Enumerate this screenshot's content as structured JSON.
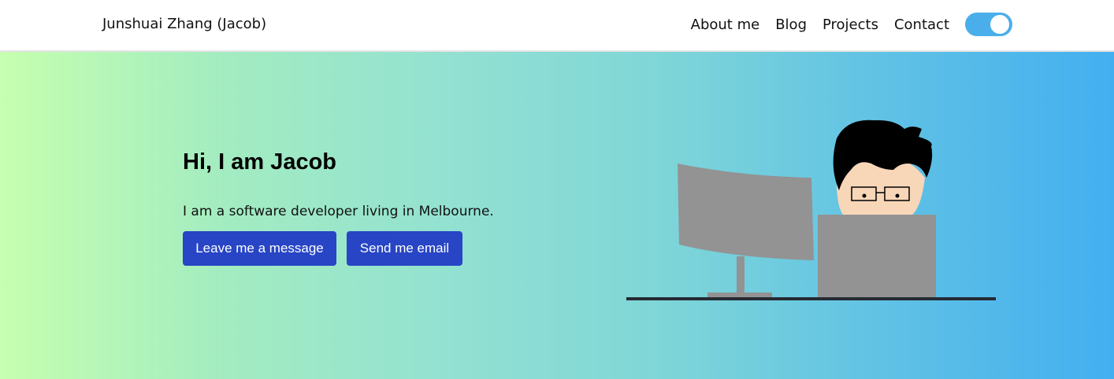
{
  "header": {
    "brand": "Junshuai Zhang (Jacob)",
    "nav": [
      "About me",
      "Blog",
      "Projects",
      "Contact"
    ],
    "theme_toggle": {
      "state": "on",
      "color": "#4aaeea"
    }
  },
  "hero": {
    "title": "Hi, I am Jacob",
    "subtitle": "I am a software developer living in Melbourne.",
    "buttons": {
      "message": "Leave me a message",
      "email": "Send me email"
    },
    "gradient_colors": [
      "#c6ffaf",
      "#43aff0"
    ],
    "button_color": "#2745c5"
  },
  "icons": {
    "illustration": "developer-at-desk-illustration"
  }
}
